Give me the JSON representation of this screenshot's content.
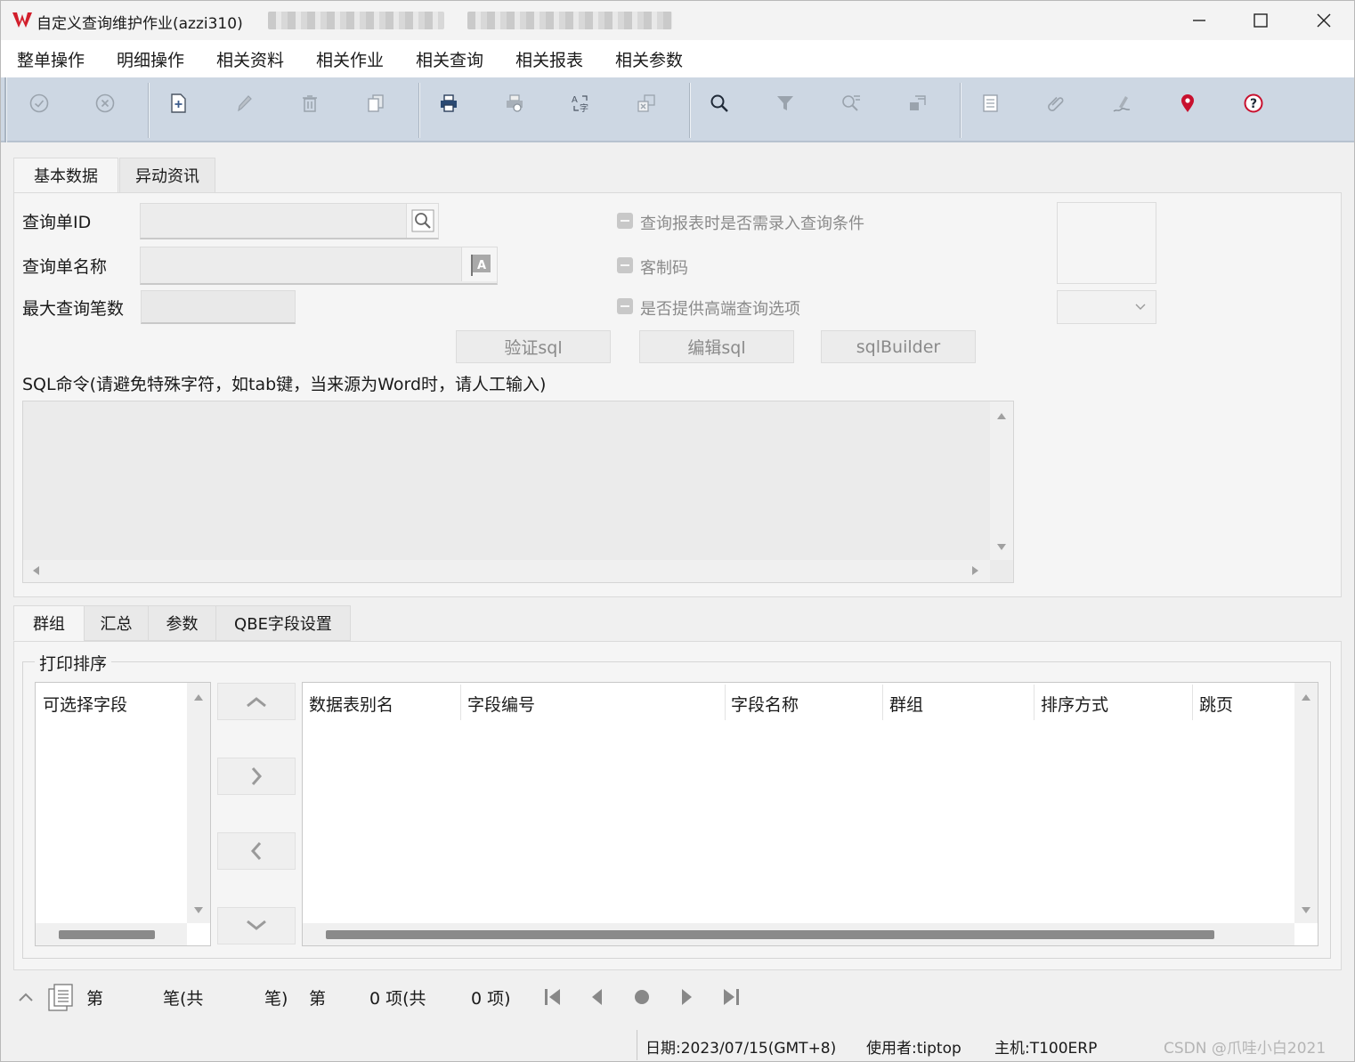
{
  "window": {
    "title": "自定义查询维护作业(azzi310)",
    "minimize_glyph": "—",
    "maximize_glyph": "☐",
    "close_glyph": "✕"
  },
  "menubar": [
    "整单操作",
    "明细操作",
    "相关资料",
    "相关作业",
    "相关查询",
    "相关报表",
    "相关参数"
  ],
  "toolbar": {
    "icons": [
      "confirm-icon",
      "cancel-icon",
      "new-doc-icon",
      "edit-icon",
      "delete-icon",
      "copy-icon",
      "print-icon",
      "print-preview-icon",
      "translate-icon",
      "export-icon",
      "search-icon",
      "filter-icon",
      "advanced-query-icon",
      "clear-query-icon",
      "notes-icon",
      "attachment-icon",
      "sign-icon",
      "location-pin-icon",
      "help-icon"
    ],
    "accent_red": "#c8102e"
  },
  "top_tabs": [
    "基本数据",
    "异动资讯"
  ],
  "form": {
    "query_id_label": "查询单ID",
    "query_id_value": "",
    "query_name_label": "查询单名称",
    "query_name_value": "",
    "max_rows_label": "最大查询笔数",
    "max_rows_value": "",
    "chk_input_conditions": "查询报表时是否需录入查询条件",
    "chk_custom_code": "客制码",
    "chk_advanced_options": "是否提供高端查询选项",
    "btn_validate_sql": "验证sql",
    "btn_edit_sql": "编辑sql",
    "btn_sql_builder": "sqlBuilder",
    "sql_label": "SQL命令(请避免特殊字符，如tab键，当来源为Word时，请人工输入)",
    "sql_value": ""
  },
  "bottom_tabs": [
    "群组",
    "汇总",
    "参数",
    "QBE字段设置"
  ],
  "group_section": {
    "legend": "打印排序",
    "available_header": "可选择字段",
    "columns": [
      "数据表别名",
      "字段编号",
      "字段名称",
      "群组",
      "排序方式",
      "跳页"
    ]
  },
  "nav": {
    "di": "第",
    "bi_gong": "笔(共",
    "bi_close": "笔)",
    "di2": "第",
    "item_count_text": "0 项(共",
    "total_items_text": "0 项)"
  },
  "status": {
    "date": "日期:2023/07/15(GMT+8)",
    "user": "使用者:tiptop",
    "host": "主机:T100ERP",
    "watermark": "CSDN @爪哇小白2021"
  }
}
